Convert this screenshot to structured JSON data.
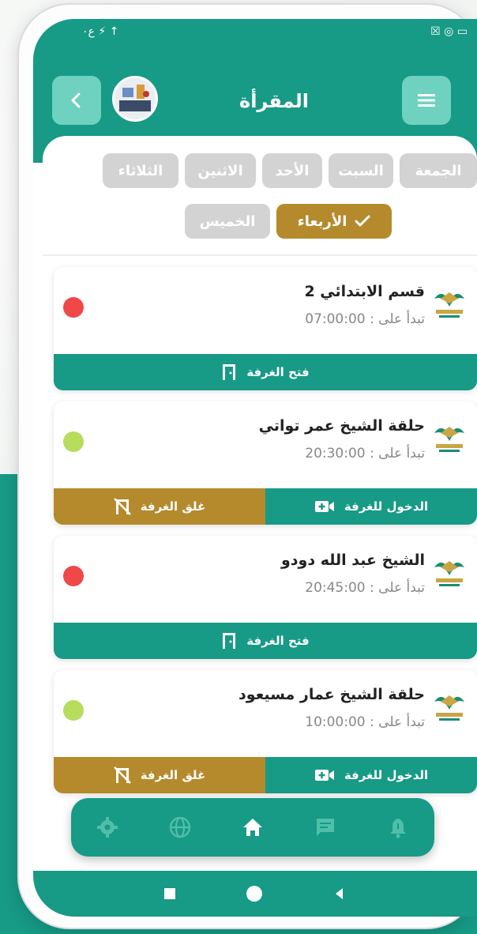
{
  "status_bar": {
    "left_text": "ع٠ ⚡ ↑",
    "right_text": "☒ ◎ ▭"
  },
  "header": {
    "title": "المقرأة",
    "back_icon": "chevron-left-icon",
    "menu_icon": "hamburger-menu-icon"
  },
  "days": {
    "row1": [
      "الجمعة",
      "السبت",
      "الأحد",
      "الاثنين",
      "الثلاثاء"
    ],
    "row2": [
      "الأربعاء",
      "الخميس"
    ],
    "selected": "الأربعاء"
  },
  "rooms": [
    {
      "name": "قسم الابتدائي 2",
      "time": "تبدأ على : 07:00:00",
      "status_color": "#f04848",
      "actions": [
        {
          "label": "فتح الغرفة",
          "color": "teal",
          "icon": "door-open-icon"
        }
      ]
    },
    {
      "name": "حلقة الشيخ عمر تواتي",
      "time": "تبدأ على : 20:30:00",
      "status_color": "#b6dd5c",
      "actions": [
        {
          "label": "الدخول للغرفة",
          "color": "teal",
          "icon": "video-camera-icon"
        },
        {
          "label": "غلق الغرفة",
          "color": "gold",
          "icon": "door-closed-icon"
        }
      ]
    },
    {
      "name": "الشيخ عبد الله دودو",
      "time": "تبدأ على : 20:45:00",
      "status_color": "#f04848",
      "actions": [
        {
          "label": "فتح الغرفة",
          "color": "teal",
          "icon": "door-open-icon"
        }
      ]
    },
    {
      "name": "حلقة الشيخ عمار مسيعود",
      "time": "تبدأ على : 10:00:00",
      "status_color": "#b6dd5c",
      "actions": [
        {
          "label": "الدخول للغرفة",
          "color": "teal",
          "icon": "video-camera-icon"
        },
        {
          "label": "غلق الغرفة",
          "color": "gold",
          "icon": "door-closed-icon"
        }
      ]
    }
  ],
  "bottom_nav": [
    "gear-icon",
    "globe-icon",
    "home-icon",
    "chat-icon",
    "bell-icon"
  ],
  "colors": {
    "primary": "#179a86",
    "accent": "#b48a2c",
    "chip_inactive": "#d3d3d3"
  }
}
